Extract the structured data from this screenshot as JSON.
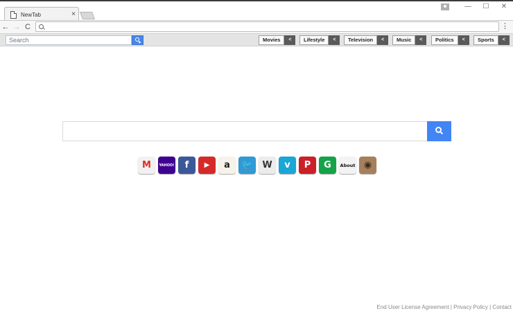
{
  "browser": {
    "tab_title": "NewTab",
    "tab_close": "×",
    "back": "←",
    "forward": "→",
    "reload": "C",
    "address_value": "",
    "menu": "⋮",
    "window": {
      "minimize": "—",
      "maximize": "☐",
      "close": "✕"
    }
  },
  "toolbar": {
    "search_placeholder": "Search",
    "categories": [
      {
        "label": "Movies",
        "arrow": "<"
      },
      {
        "label": "Lifestyle",
        "arrow": "<"
      },
      {
        "label": "Television",
        "arrow": "<"
      },
      {
        "label": "Music",
        "arrow": "<"
      },
      {
        "label": "Politics",
        "arrow": "<"
      },
      {
        "label": "Sports",
        "arrow": "<"
      }
    ]
  },
  "main": {
    "search_value": ""
  },
  "shortcuts": [
    {
      "name": "gmail-icon",
      "glyph": "M",
      "bg": "#f1f1f1",
      "fg": "#d93025"
    },
    {
      "name": "yahoo-icon",
      "glyph": "YAHOO!",
      "bg": "#400191",
      "fg": "#ffffff"
    },
    {
      "name": "facebook-icon",
      "glyph": "f",
      "bg": "#3b5998",
      "fg": "#ffffff"
    },
    {
      "name": "youtube-icon",
      "glyph": "▶",
      "bg": "#d62a2a",
      "fg": "#ffffff"
    },
    {
      "name": "amazon-icon",
      "glyph": "a",
      "bg": "#f7f3ea",
      "fg": "#222222"
    },
    {
      "name": "twitter-icon",
      "glyph": "🐦",
      "bg": "#2f9ad6",
      "fg": "#ffffff"
    },
    {
      "name": "wikipedia-icon",
      "glyph": "W",
      "bg": "#ececec",
      "fg": "#333333"
    },
    {
      "name": "vimeo-icon",
      "glyph": "v",
      "bg": "#1aa6d6",
      "fg": "#ffffff"
    },
    {
      "name": "pinterest-icon",
      "glyph": "P",
      "bg": "#cb2027",
      "fg": "#ffffff"
    },
    {
      "name": "grammarly-icon",
      "glyph": "G",
      "bg": "#15a34a",
      "fg": "#ffffff"
    },
    {
      "name": "about-icon",
      "glyph": "About",
      "bg": "#f3f3f3",
      "fg": "#111111"
    },
    {
      "name": "instagram-icon",
      "glyph": "◉",
      "bg": "#a6805c",
      "fg": "#3b2a1a"
    }
  ],
  "footer": {
    "eula": "End User License Agreement",
    "sep1": " | ",
    "privacy": "Privacy Policy",
    "sep2": " | ",
    "contact": "Contact"
  }
}
